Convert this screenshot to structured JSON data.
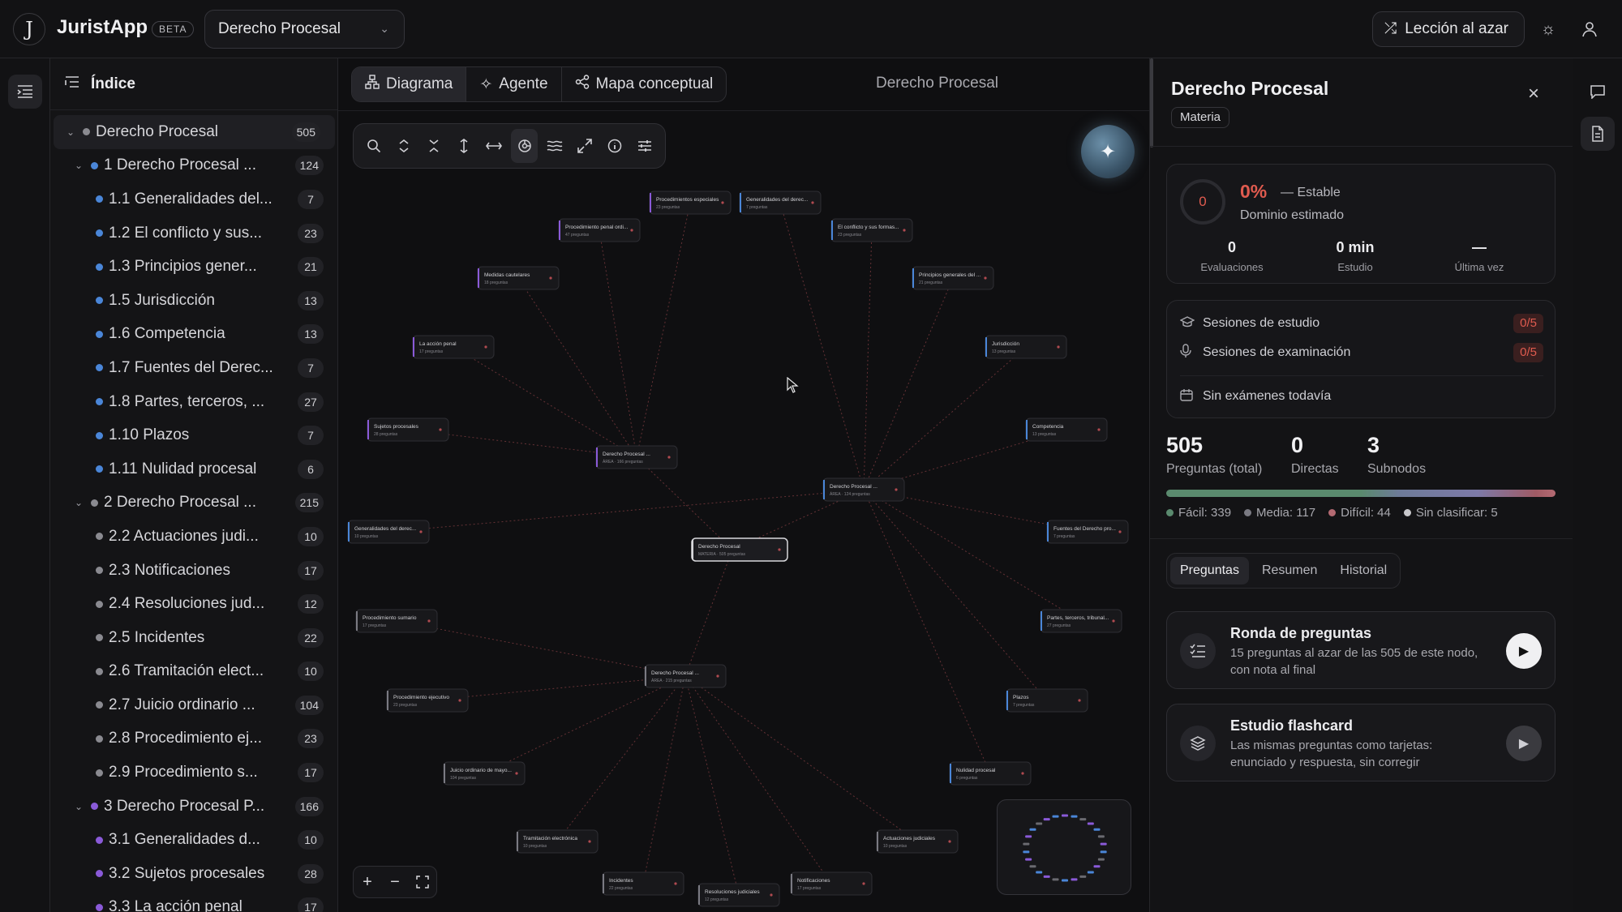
{
  "header": {
    "logo_letter": "J",
    "app_name": "JuristApp",
    "beta": "BETA",
    "subject": "Derecho Procesal",
    "random_lesson": "Lección al azar"
  },
  "sidebar": {
    "title": "Índice",
    "items": [
      {
        "label": "Derecho Procesal",
        "count": "505",
        "level": 0,
        "caret": true,
        "dot": "#8a8a90"
      },
      {
        "label": "1  Derecho Procesal ...",
        "count": "124",
        "level": 1,
        "caret": true,
        "dot": "#4a86d8"
      },
      {
        "label": "1.1  Generalidades del...",
        "count": "7",
        "level": 2,
        "dot": "#4a86d8"
      },
      {
        "label": "1.2  El conflicto y sus...",
        "count": "23",
        "level": 2,
        "dot": "#4a86d8"
      },
      {
        "label": "1.3  Principios gener...",
        "count": "21",
        "level": 2,
        "dot": "#4a86d8"
      },
      {
        "label": "1.5  Jurisdicción",
        "count": "13",
        "level": 2,
        "dot": "#4a86d8"
      },
      {
        "label": "1.6  Competencia",
        "count": "13",
        "level": 2,
        "dot": "#4a86d8"
      },
      {
        "label": "1.7  Fuentes del Derec...",
        "count": "7",
        "level": 2,
        "dot": "#4a86d8"
      },
      {
        "label": "1.8  Partes, terceros, ...",
        "count": "27",
        "level": 2,
        "dot": "#4a86d8"
      },
      {
        "label": "1.10  Plazos",
        "count": "7",
        "level": 2,
        "dot": "#4a86d8"
      },
      {
        "label": "1.11  Nulidad procesal",
        "count": "6",
        "level": 2,
        "dot": "#4a86d8"
      },
      {
        "label": "2  Derecho Procesal ...",
        "count": "215",
        "level": 1,
        "caret": true,
        "dot": "#8a8a90"
      },
      {
        "label": "2.2  Actuaciones judi...",
        "count": "10",
        "level": 2,
        "dot": "#8a8a90"
      },
      {
        "label": "2.3  Notificaciones",
        "count": "17",
        "level": 2,
        "dot": "#8a8a90"
      },
      {
        "label": "2.4  Resoluciones jud...",
        "count": "12",
        "level": 2,
        "dot": "#8a8a90"
      },
      {
        "label": "2.5  Incidentes",
        "count": "22",
        "level": 2,
        "dot": "#8a8a90"
      },
      {
        "label": "2.6  Tramitación elect...",
        "count": "10",
        "level": 2,
        "dot": "#8a8a90"
      },
      {
        "label": "2.7  Juicio ordinario ...",
        "count": "104",
        "level": 2,
        "dot": "#8a8a90"
      },
      {
        "label": "2.8  Procedimiento ej...",
        "count": "23",
        "level": 2,
        "dot": "#8a8a90"
      },
      {
        "label": "2.9  Procedimiento s...",
        "count": "17",
        "level": 2,
        "dot": "#8a8a90"
      },
      {
        "label": "3  Derecho Procesal P...",
        "count": "166",
        "level": 1,
        "caret": true,
        "dot": "#8a5ad8"
      },
      {
        "label": "3.1  Generalidades d...",
        "count": "10",
        "level": 2,
        "dot": "#8a5ad8"
      },
      {
        "label": "3.2  Sujetos procesales",
        "count": "28",
        "level": 2,
        "dot": "#8a5ad8"
      },
      {
        "label": "3.3  La acción penal",
        "count": "17",
        "level": 2,
        "dot": "#8a5ad8"
      }
    ]
  },
  "center": {
    "tabs": [
      "Diagrama",
      "Agente",
      "Mapa conceptual"
    ],
    "title": "Derecho Procesal",
    "nodes": [
      {
        "t": "Procedimientos especiales",
        "s": "23 preguntas"
      },
      {
        "t": "Generalidades del derec...",
        "s": "7 preguntas"
      },
      {
        "t": "Procedimiento penal ordi...",
        "s": "47 preguntas"
      },
      {
        "t": "El conflicto y sus formas...",
        "s": "23 preguntas"
      },
      {
        "t": "Medidas cautelares",
        "s": "18 preguntas"
      },
      {
        "t": "Principios generales del ...",
        "s": "21 preguntas"
      },
      {
        "t": "La acción penal",
        "s": "17 preguntas"
      },
      {
        "t": "Jurisdicción",
        "s": "13 preguntas"
      },
      {
        "t": "Sujetos procesales",
        "s": "28 preguntas"
      },
      {
        "t": "Competencia",
        "s": "13 preguntas"
      },
      {
        "t": "Derecho Procesal ...",
        "s": "ÁREA · 166 preguntas"
      },
      {
        "t": "Derecho Procesal ...",
        "s": "ÁREA · 124 preguntas"
      },
      {
        "t": "Generalidades del derec...",
        "s": "10 preguntas"
      },
      {
        "t": "Fuentes del Derecho pro...",
        "s": "7 preguntas"
      },
      {
        "t": "Derecho Procesal",
        "s": "MATERIA · 505 preguntas"
      },
      {
        "t": "Procedimiento sumario",
        "s": "17 preguntas"
      },
      {
        "t": "Partes, terceros, tribunal...",
        "s": "27 preguntas"
      },
      {
        "t": "Derecho Procesal ...",
        "s": "ÁREA · 215 preguntas"
      },
      {
        "t": "Procedimiento ejecutivo",
        "s": "23 preguntas"
      },
      {
        "t": "Plazos",
        "s": "7 preguntas"
      },
      {
        "t": "Juicio ordinario de mayo...",
        "s": "104 preguntas"
      },
      {
        "t": "Nulidad procesal",
        "s": "6 preguntas"
      },
      {
        "t": "Tramitación electrónica",
        "s": "10 preguntas"
      },
      {
        "t": "Actuaciones judiciales",
        "s": "10 preguntas"
      },
      {
        "t": "Incidentes",
        "s": "22 preguntas"
      },
      {
        "t": "Notificaciones",
        "s": "17 preguntas"
      },
      {
        "t": "Resoluciones judiciales",
        "s": "12 preguntas"
      }
    ]
  },
  "panel": {
    "title": "Derecho Procesal",
    "tag": "Materia",
    "mastery_ring": "0",
    "mastery_pct": "0%",
    "trend": "— Estable",
    "mastery_label": "Dominio estimado",
    "stats": [
      {
        "value": "0",
        "label": "Evaluaciones"
      },
      {
        "value": "0 min",
        "label": "Estudio"
      },
      {
        "value": "—",
        "label": "Última vez"
      }
    ],
    "sessions": [
      {
        "label": "Sesiones de estudio",
        "badge": "0/5"
      },
      {
        "label": "Sesiones de examinación",
        "badge": "0/5"
      }
    ],
    "no_exams": "Sin exámenes todavía",
    "totals": [
      {
        "value": "505",
        "label": "Preguntas (total)"
      },
      {
        "value": "0",
        "label": "Directas"
      },
      {
        "value": "3",
        "label": "Subnodos"
      }
    ],
    "legend": [
      {
        "label": "Fácil: 339",
        "color": "#5a8a6e"
      },
      {
        "label": "Media: 117",
        "color": "#7a7a82"
      },
      {
        "label": "Difícil: 44",
        "color": "#b46a72"
      },
      {
        "label": "Sin clasificar: 5",
        "color": "#c8c8cc"
      }
    ],
    "tabs": [
      "Preguntas",
      "Resumen",
      "Historial"
    ],
    "actions": [
      {
        "title": "Ronda de preguntas",
        "desc": "15 preguntas al azar de las 505 de este nodo, con nota al final"
      },
      {
        "title": "Estudio flashcard",
        "desc": "Las mismas preguntas como tarjetas: enunciado y respuesta, sin corregir"
      }
    ]
  },
  "difficulty": {
    "easy": 339,
    "medium": 117,
    "hard": 44,
    "unclassified": 5
  }
}
